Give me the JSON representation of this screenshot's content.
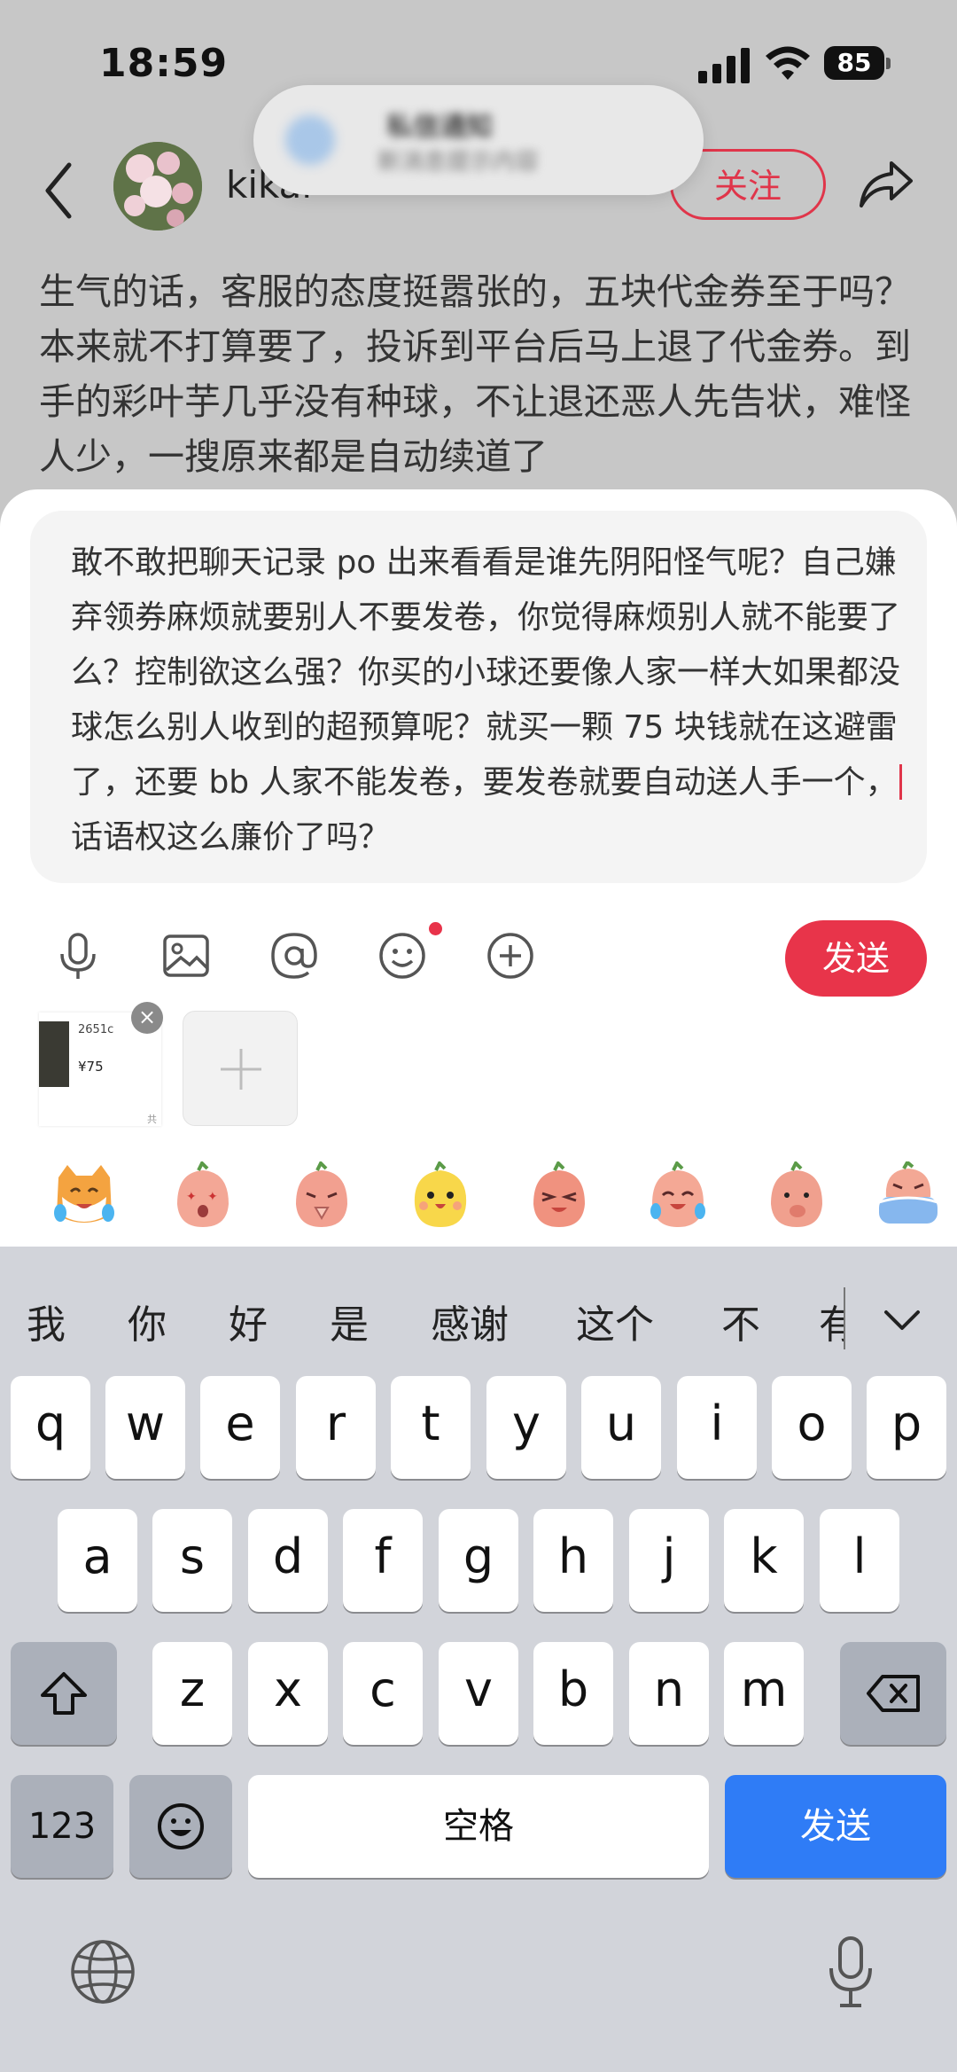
{
  "status_bar": {
    "time": "18:59",
    "battery": "85"
  },
  "header": {
    "username": "kikal",
    "follow_label": "关注"
  },
  "notification": {
    "title": "私信通知",
    "body": "新消息提示内容"
  },
  "post": {
    "text": "生气的话，客服的态度挺嚣张的，五块代金券至于吗？本来就不打算要了，投诉到平台后马上退了代金券。到手的彩叶芋几乎没有种球，不让退还恶人先告状，难怪人少，一搜原来都是自动续道了"
  },
  "reply": {
    "text_before_caret": "敢不敢把聊天记录 po 出来看看是谁先阴阳怪气呢？自己嫌弃领券麻烦就要别人不要发卷，你觉得麻烦别人就不能要了么？控制欲这么强？你买的小球还要像人家一样大如果都没球怎么别人收到的超预算呢？就买一颗 75 块钱就在这避雷了，还要 bb 人家不能发卷，要发卷就要自动送人手一个，",
    "text_after_caret": "话语权这么廉价了吗？"
  },
  "toolbar": {
    "icons": [
      "microphone-icon",
      "image-icon",
      "at-icon",
      "emoji-icon",
      "plus-circle-icon"
    ],
    "send_label": "发送"
  },
  "attachment": {
    "sku": "2651c",
    "price": "¥75",
    "extra": "共"
  },
  "stickers": [
    "cat-cry-laugh",
    "peach-starry-eyes",
    "peach-pray",
    "chick-happy",
    "peach-wink",
    "peach-cry-laugh",
    "peach-shy",
    "peach-cry-bath"
  ],
  "keyboard": {
    "candidates": [
      "我",
      "你",
      "好",
      "是",
      "感谢",
      "这个",
      "不",
      "有"
    ],
    "row1": [
      "q",
      "w",
      "e",
      "r",
      "t",
      "y",
      "u",
      "i",
      "o",
      "p"
    ],
    "row2": [
      "a",
      "s",
      "d",
      "f",
      "g",
      "h",
      "j",
      "k",
      "l"
    ],
    "row3": [
      "z",
      "x",
      "c",
      "v",
      "b",
      "n",
      "m"
    ],
    "num_label": "123",
    "space_label": "空格",
    "send_label": "发送"
  },
  "colors": {
    "accent": "#e8344a",
    "keyboard_send": "#2f7cf6",
    "keyboard_bg": "#d2d4da"
  }
}
